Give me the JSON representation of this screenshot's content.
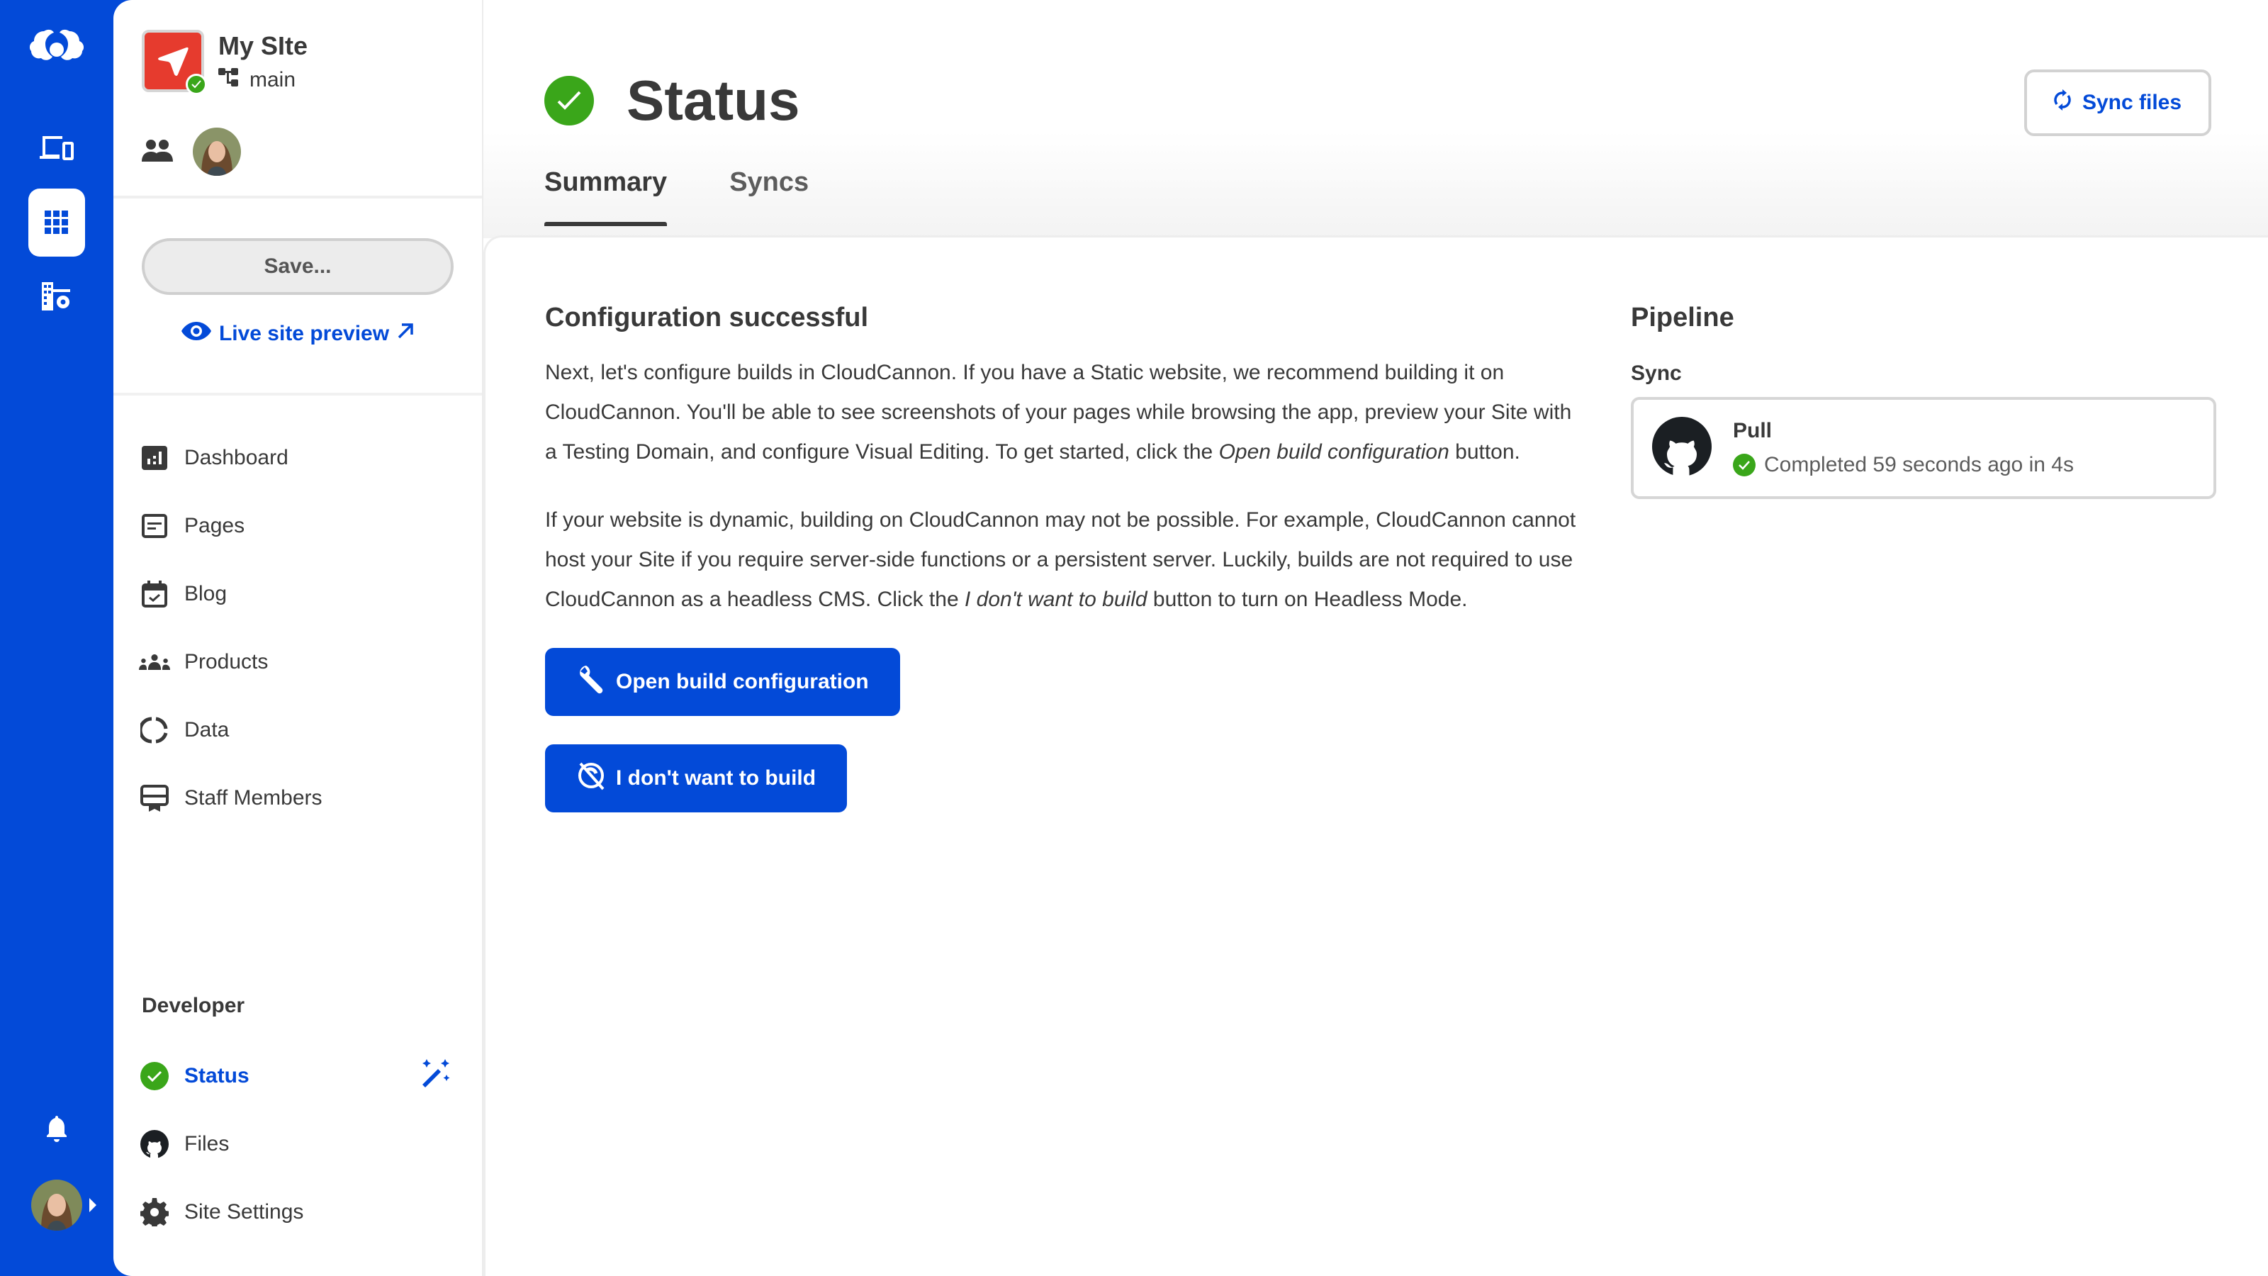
{
  "colors": {
    "brand": "#034ad8",
    "success": "#3aa61a",
    "text": "#393939",
    "site_thumb": "#e63b2e"
  },
  "rail": {
    "icons": [
      "cloudcannon-logo-icon",
      "devices-icon",
      "apps-grid-icon",
      "organization-settings-icon",
      "bell-icon"
    ]
  },
  "site": {
    "name": "My SIte",
    "branch": "main",
    "save_label": "Save...",
    "live_preview_label": "Live site preview"
  },
  "nav": {
    "items": [
      {
        "label": "Dashboard",
        "icon": "dashboard-icon"
      },
      {
        "label": "Pages",
        "icon": "pages-icon"
      },
      {
        "label": "Blog",
        "icon": "calendar-check-icon"
      },
      {
        "label": "Products",
        "icon": "group-icon"
      },
      {
        "label": "Data",
        "icon": "data-ring-icon"
      },
      {
        "label": "Staff Members",
        "icon": "card-icon"
      }
    ],
    "developer_title": "Developer",
    "developer_items": [
      {
        "label": "Status",
        "icon": "check-circle-icon",
        "active": true
      },
      {
        "label": "Files",
        "icon": "github-icon"
      },
      {
        "label": "Site Settings",
        "icon": "gear-icon"
      }
    ]
  },
  "header": {
    "title": "Status",
    "sync_label": "Sync files",
    "tabs": [
      {
        "label": "Summary",
        "active": true
      },
      {
        "label": "Syncs",
        "active": false
      }
    ]
  },
  "summary": {
    "heading": "Configuration successful",
    "para1_a": "Next, let's configure builds in CloudCannon. If you have a Static website, we recommend building it on CloudCannon. You'll be able to see screenshots of your pages while browsing the app, preview your Site with a Testing Domain, and configure Visual Editing. To get started, click the ",
    "para1_em": "Open build configuration",
    "para1_b": " button.",
    "para2_a": "If your website is dynamic, building on CloudCannon may not be possible. For example, CloudCannon cannot host your Site if you require server-side functions or a persistent server. Luckily, builds are not required to use CloudCannon as a headless CMS. Click the ",
    "para2_em": "I don't want to build",
    "para2_b": " button to turn on Headless Mode.",
    "open_build_label": "Open build configuration",
    "no_build_label": "I don't want to build"
  },
  "pipeline": {
    "title": "Pipeline",
    "section": "Sync",
    "step_name": "Pull",
    "step_status": "Completed 59 seconds ago in 4s"
  }
}
